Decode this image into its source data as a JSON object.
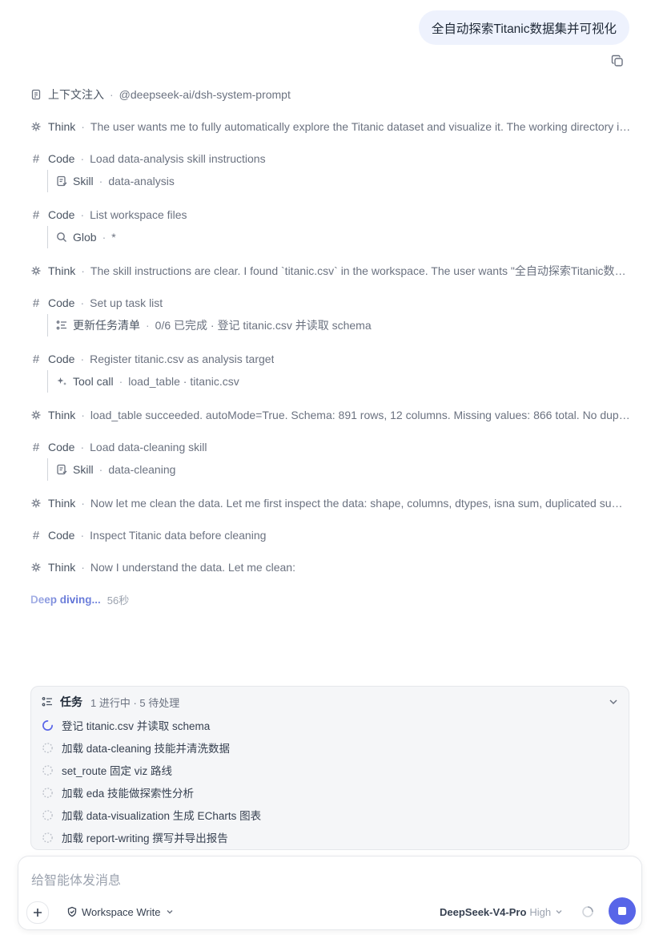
{
  "user_message": "全自动探索Titanic数据集并可视化",
  "icons": {
    "copy": "copy-icon",
    "context": "document-icon",
    "think": "brain-icon",
    "code": "hash-icon",
    "skill": "skill-icon",
    "glob": "search-icon",
    "tasklist": "list-icon",
    "toolcall": "sparkle-icon",
    "chevron": "chevron-down-icon",
    "workspace": "shield-icon",
    "stop": "stop-icon"
  },
  "steps": [
    {
      "kind": "上下文注入",
      "sep": "·",
      "desc": "@deepseek-ai/dsh-system-prompt"
    },
    {
      "kind": "Think",
      "sep": "·",
      "desc": "The user wants me to fully automatically explore the Titanic dataset and visualize it. The working directory is..."
    },
    {
      "kind": "Code",
      "sep": "·",
      "desc": "Load data-analysis skill instructions",
      "sub": {
        "kind": "Skill",
        "sep": "·",
        "desc": "data-analysis"
      }
    },
    {
      "kind": "Code",
      "sep": "·",
      "desc": "List workspace files",
      "sub": {
        "kind": "Glob",
        "sep": "·",
        "desc": "*"
      }
    },
    {
      "kind": "Think",
      "sep": "·",
      "desc": "The skill instructions are clear. I found `titanic.csv` in the workspace. The user wants \"全自动探索Titanic数据..."
    },
    {
      "kind": "Code",
      "sep": "·",
      "desc": "Set up task list",
      "sub": {
        "kind": "更新任务清单",
        "sep": "·",
        "desc": "0/6 已完成 · 登记 titanic.csv 并读取 schema"
      }
    },
    {
      "kind": "Code",
      "sep": "·",
      "desc": "Register titanic.csv as analysis target",
      "sub": {
        "kind": "Tool call",
        "sep": "·",
        "desc": "load_table · titanic.csv"
      }
    },
    {
      "kind": "Think",
      "sep": "·",
      "desc": "load_table succeeded. autoMode=True. Schema: 891 rows, 12 columns. Missing values: 866 total. No duplic..."
    },
    {
      "kind": "Code",
      "sep": "·",
      "desc": "Load data-cleaning skill",
      "sub": {
        "kind": "Skill",
        "sep": "·",
        "desc": "data-cleaning"
      }
    },
    {
      "kind": "Think",
      "sep": "·",
      "desc": "Now let me clean the data. Let me first inspect the data: shape, columns, dtypes, isna sum, duplicated sum. ..."
    },
    {
      "kind": "Code",
      "sep": "·",
      "desc": "Inspect Titanic data before cleaning"
    },
    {
      "kind": "Think",
      "sep": "·",
      "desc": "Now I understand the data. Let me clean:"
    }
  ],
  "status": {
    "label": "Deep diving...",
    "elapsed": "56秒"
  },
  "tasks": {
    "title": "任务",
    "meta": "1 进行中 · 5 待处理",
    "items": [
      {
        "label": "登记 titanic.csv 并读取 schema",
        "state": "in_progress"
      },
      {
        "label": "加载 data-cleaning 技能并清洗数据",
        "state": "pending"
      },
      {
        "label": "set_route 固定 viz 路线",
        "state": "pending"
      },
      {
        "label": "加载 eda 技能做探索性分析",
        "state": "pending"
      },
      {
        "label": "加载 data-visualization 生成 ECharts 图表",
        "state": "pending"
      },
      {
        "label": "加载 report-writing 撰写并导出报告",
        "state": "pending"
      }
    ]
  },
  "composer": {
    "placeholder": "给智能体发消息",
    "workspace_label": "Workspace Write",
    "model_name": "DeepSeek-V4-Pro",
    "model_level": "High"
  },
  "colors": {
    "accent": "#5865e8",
    "bubble": "#eef2fd"
  }
}
